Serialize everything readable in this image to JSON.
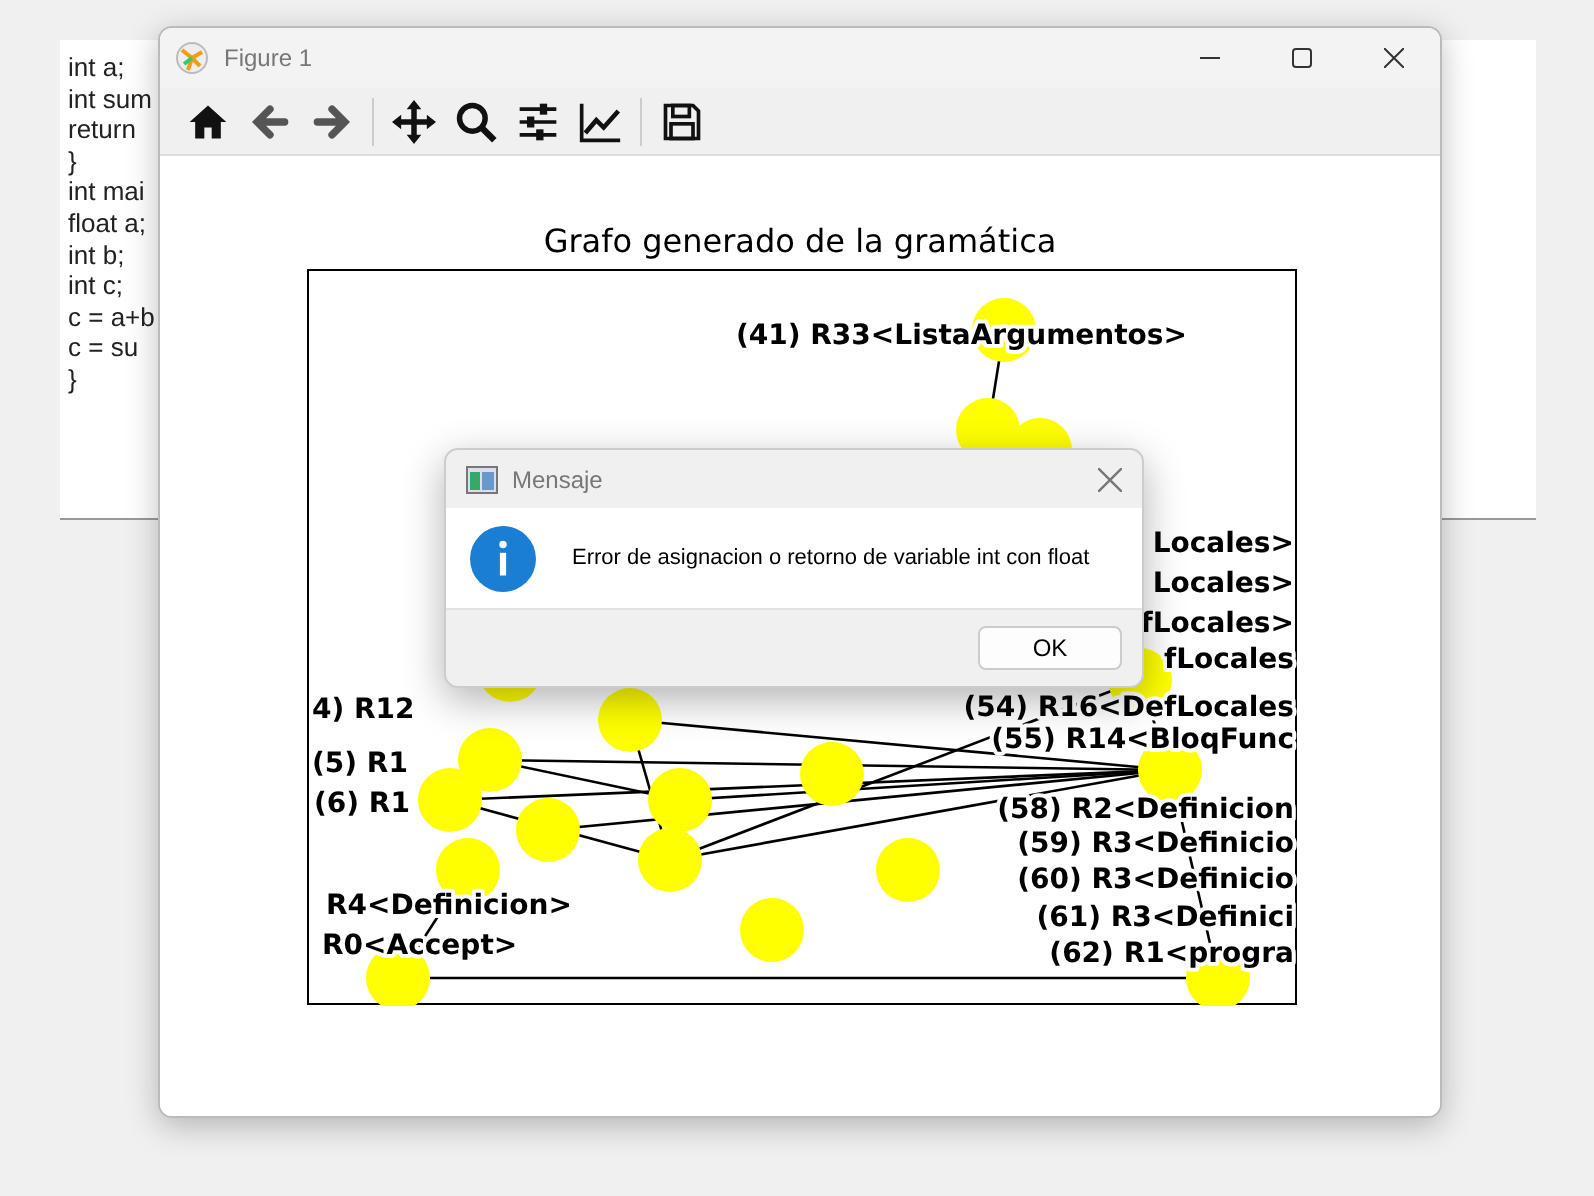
{
  "editor": {
    "lines": [
      "int a;",
      "int sum",
      "return",
      "}",
      "int mai",
      "float a;",
      "int b;",
      "int c;",
      "c = a+b",
      "c = su",
      "}"
    ]
  },
  "figure_window": {
    "title": "Figure 1",
    "toolbar": [
      {
        "kind": "home"
      },
      {
        "kind": "back"
      },
      {
        "kind": "forward"
      },
      {
        "kind": "pan"
      },
      {
        "kind": "zoom"
      },
      {
        "kind": "subplots"
      },
      {
        "kind": "axes"
      },
      {
        "kind": "save"
      }
    ],
    "plot": {
      "title": "Grafo generado de la gramática",
      "labels": [
        "(41) R33<ListaArgumentos>",
        "Locales>",
        "Locales>",
        "fLocales>",
        "fLocales",
        "(54) R16<DefLocales",
        "(55) R14<BloqFunc",
        "(58) R2<Definicion",
        "(59) R3<Definicio",
        "(60) R3<Definicio",
        "(61) R3<Definici",
        "(62) R1<progra",
        "4) R12",
        "(5) R1",
        "(6) R1",
        "R4<Definicion>",
        "R0<Accept>"
      ]
    }
  },
  "dialog": {
    "title": "Mensaje",
    "message": "Error de asignacion o retorno de variable int con float",
    "button": "OK"
  }
}
